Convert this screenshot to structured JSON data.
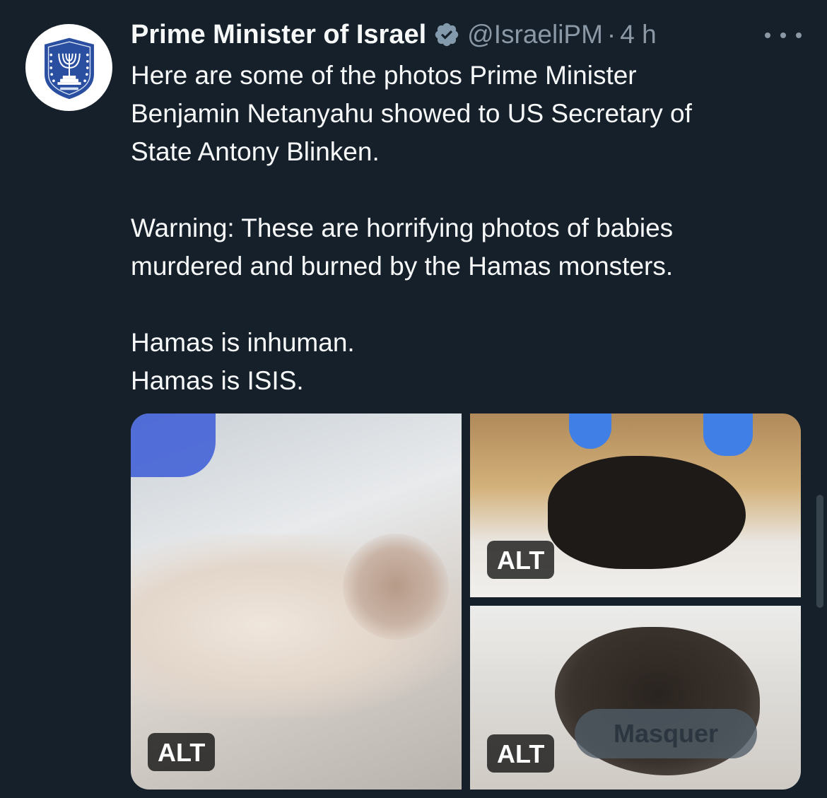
{
  "author": {
    "display_name": "Prime Minister of Israel",
    "handle": "@IsraeliPM",
    "separator": "·",
    "time": "4 h",
    "verified": true,
    "avatar_icon": "state-emblem-menorah-icon"
  },
  "tweet": {
    "paragraphs": [
      [
        "Here are some of the photos Prime Minister",
        "Benjamin Netanyahu showed to US Secretary of",
        "State Antony Blinken."
      ],
      [
        "Warning: These are horrifying photos of babies",
        "murdered and burned by the Hamas monsters."
      ],
      [
        "Hamas is inhuman.",
        "Hamas is ISIS."
      ]
    ]
  },
  "media": {
    "photos": [
      {
        "alt_label": "ALT"
      },
      {
        "alt_label": "ALT"
      },
      {
        "alt_label": "ALT"
      }
    ],
    "hide_label": "Masquer"
  },
  "colors": {
    "background": "#15202b",
    "primary_text": "#f7f9f9",
    "secondary_text": "#8b98a5"
  }
}
